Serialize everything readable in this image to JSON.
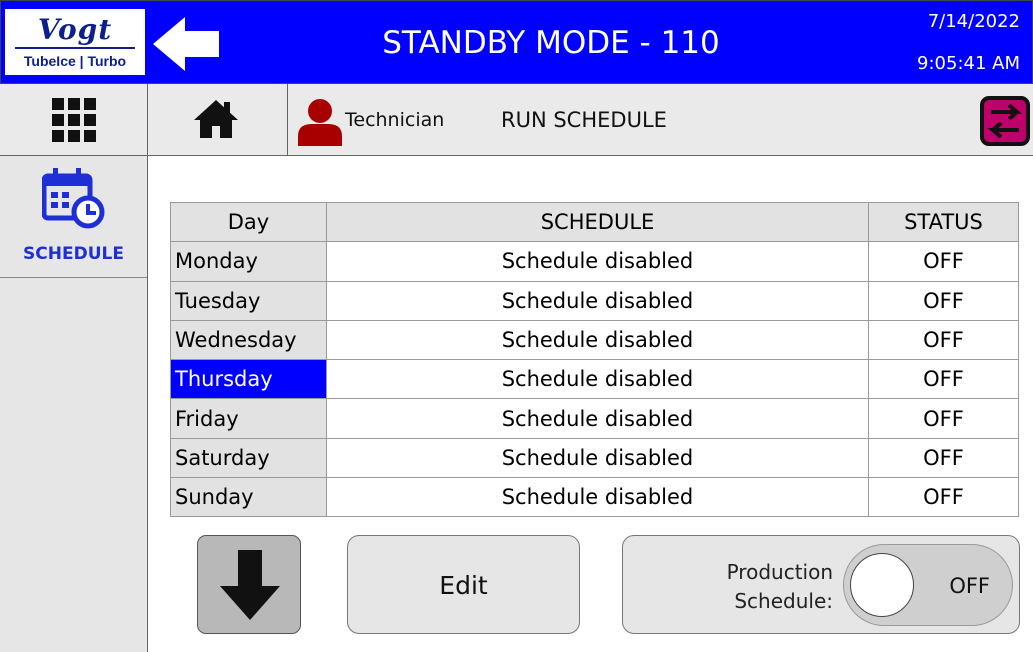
{
  "header": {
    "logo_brand": "Vogt",
    "logo_tagline": "TubeIce | Turbo",
    "title": "STANDBY MODE - 110",
    "date": "7/14/2022",
    "time": "9:05:41 AM"
  },
  "toolbar": {
    "user_role": "Technician",
    "page_label": "RUN SCHEDULE"
  },
  "sidebar": {
    "items": [
      {
        "label": "SCHEDULE",
        "icon": "calendar-clock-icon"
      }
    ]
  },
  "table": {
    "columns": [
      "Day",
      "SCHEDULE",
      "STATUS"
    ],
    "rows": [
      {
        "day": "Monday",
        "schedule": "Schedule disabled",
        "status": "OFF"
      },
      {
        "day": "Tuesday",
        "schedule": "Schedule disabled",
        "status": "OFF"
      },
      {
        "day": "Wednesday",
        "schedule": "Schedule disabled",
        "status": "OFF"
      },
      {
        "day": "Thursday",
        "schedule": "Schedule disabled",
        "status": "OFF"
      },
      {
        "day": "Friday",
        "schedule": "Schedule disabled",
        "status": "OFF"
      },
      {
        "day": "Saturday",
        "schedule": "Schedule disabled",
        "status": "OFF"
      },
      {
        "day": "Sunday",
        "schedule": "Schedule disabled",
        "status": "OFF"
      }
    ],
    "selected_day": "Thursday"
  },
  "controls": {
    "edit_label": "Edit",
    "production_label_line1": "Production",
    "production_label_line2": "Schedule:",
    "production_toggle_state": "OFF"
  },
  "colors": {
    "header_bg": "#0000ff",
    "selected_row": "#0000ff",
    "accent_magenta": "#c0006a",
    "user_icon": "#a80000"
  }
}
